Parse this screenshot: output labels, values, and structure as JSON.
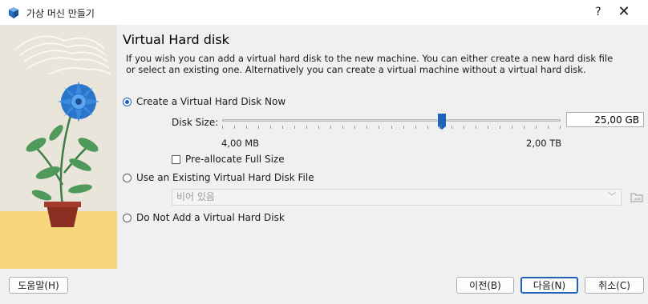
{
  "window": {
    "title": "가상 머신 만들기",
    "help_label": "?",
    "close_label": "✕",
    "app_icon": "virtualbox-cube-icon"
  },
  "page": {
    "heading": "Virtual Hard disk",
    "description": "If you wish you can add a virtual hard disk to the new machine. You can either create a new hard disk file or select an existing one. Alternatively you can create a virtual machine without a virtual hard disk."
  },
  "options": {
    "create_new": {
      "label": "Create a Virtual Hard Disk Now",
      "selected": true
    },
    "use_existing": {
      "label": "Use an Existing Virtual Hard Disk File",
      "selected": false
    },
    "do_not_add": {
      "label": "Do Not Add a Virtual Hard Disk",
      "selected": false
    }
  },
  "disk_size": {
    "label": "Disk Size:",
    "value": "25,00 GB",
    "min_label": "4,00 MB",
    "max_label": "2,00 TB",
    "slider_fraction": 0.65
  },
  "preallocate": {
    "label": "Pre-allocate Full Size",
    "checked": false
  },
  "existing_file_select": {
    "value": "비어 있음",
    "enabled": false
  },
  "footer": {
    "help_button": "도움말(H)",
    "back_button": "이전(B)",
    "next_button": "다음(N)",
    "cancel_button": "취소(C)"
  },
  "colors": {
    "accent": "#1f62b8",
    "illustration_bg": "#e6e1d5",
    "illustration_ground": "#f6d77c"
  }
}
